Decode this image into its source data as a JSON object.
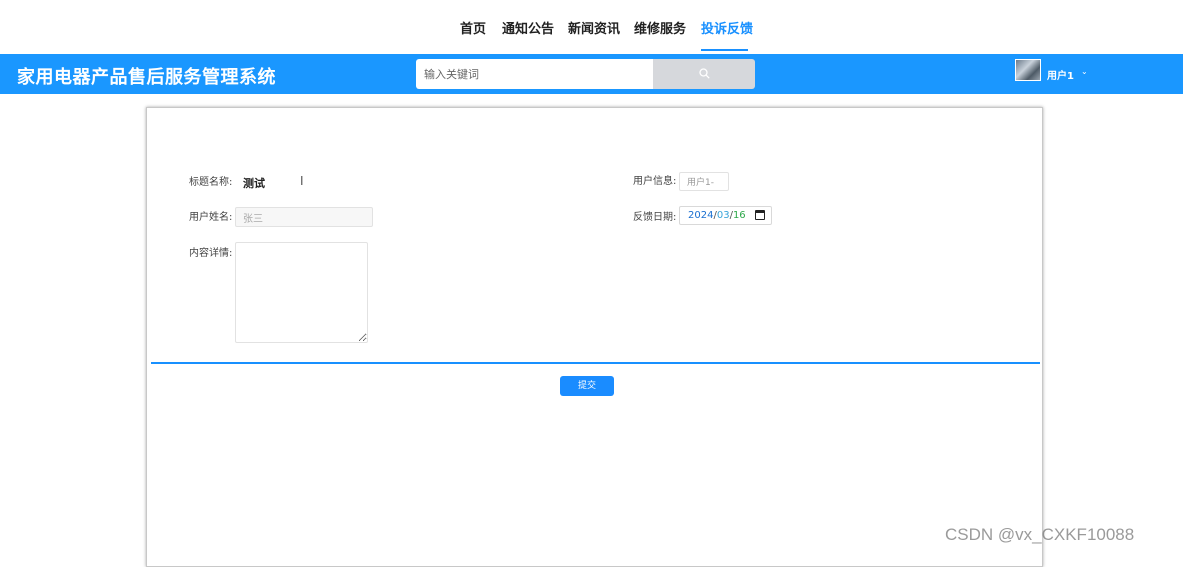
{
  "nav": {
    "items": [
      {
        "label": "首页"
      },
      {
        "label": "通知公告"
      },
      {
        "label": "新闻资讯"
      },
      {
        "label": "维修服务"
      },
      {
        "label": "投诉反馈"
      }
    ],
    "active_index": 4
  },
  "header": {
    "brand": "家用电器产品售后服务管理系统",
    "search_placeholder": "输入关键词",
    "user_name": "用户1",
    "caret": "⌄"
  },
  "form": {
    "title_label": "标题名称:",
    "title_value": "测试",
    "username_label": "用户姓名:",
    "username_value": "张三",
    "content_label": "内容详情:",
    "content_value": "",
    "userinfo_label": "用户信息:",
    "userinfo_value": "用户1-",
    "date_label": "反馈日期:",
    "date_year": "2024",
    "date_month": "03",
    "date_day": "16",
    "date_sep": "/",
    "submit_label": "提交"
  },
  "watermark": "CSDN @vx_CXKF10088",
  "colors": {
    "accent": "#1890ff",
    "header_bg": "#1a97ff"
  }
}
